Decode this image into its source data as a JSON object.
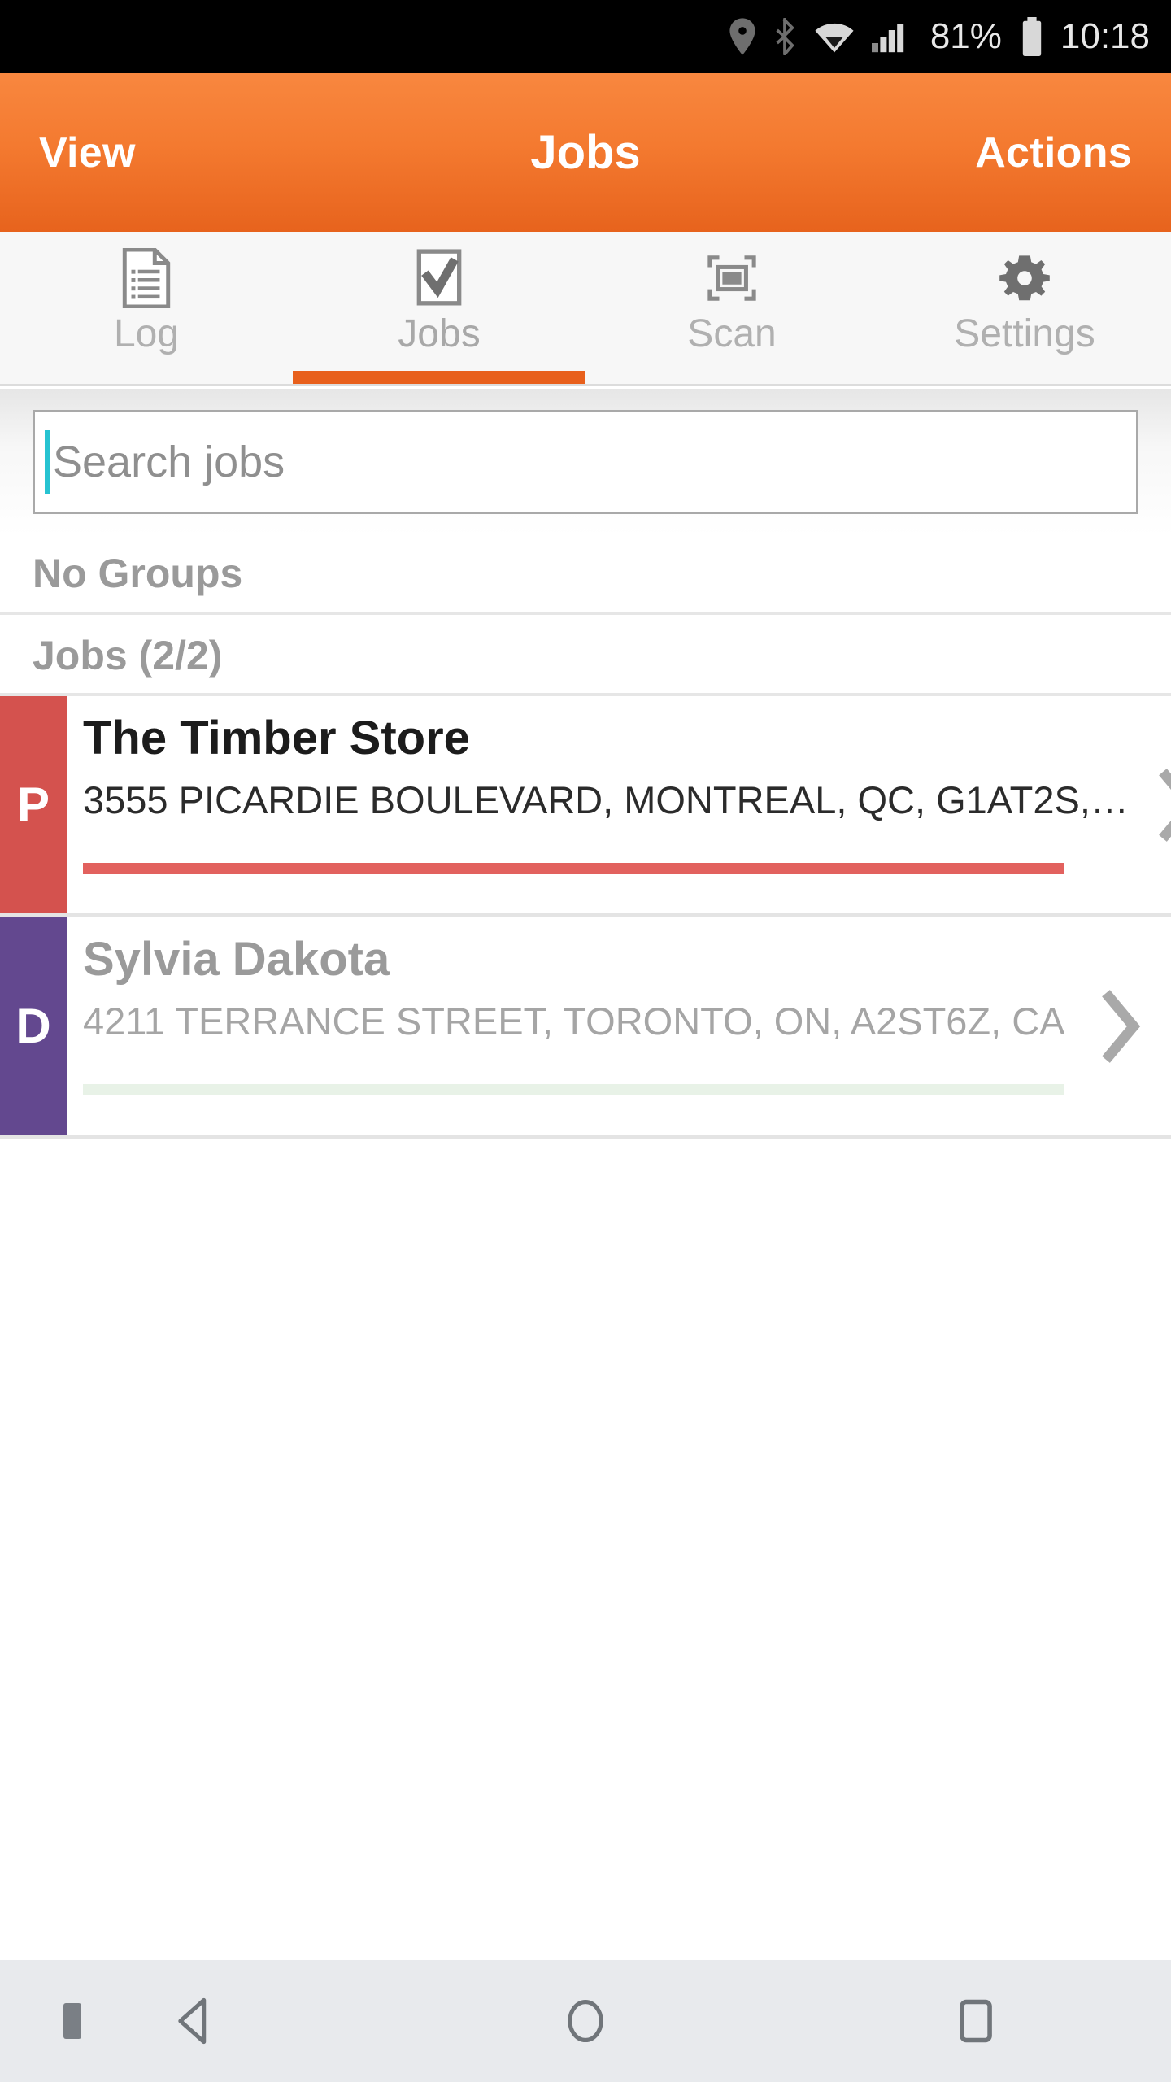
{
  "status_bar": {
    "battery_percent": "81%",
    "time": "10:18",
    "icons": [
      "location-pin-icon",
      "bluetooth-icon",
      "wifi-icon",
      "cellular-signal-icon",
      "battery-icon"
    ]
  },
  "header": {
    "left_button": "View",
    "title": "Jobs",
    "right_button": "Actions",
    "accent_color": "#e8601c"
  },
  "tabs": [
    {
      "label": "Log",
      "icon": "document-list-icon",
      "active": false
    },
    {
      "label": "Jobs",
      "icon": "checkbox-check-icon",
      "active": true
    },
    {
      "label": "Scan",
      "icon": "scan-frame-icon",
      "active": false
    },
    {
      "label": "Settings",
      "icon": "gear-icon",
      "active": false
    }
  ],
  "search": {
    "placeholder": "Search jobs",
    "value": "",
    "caret_color": "#27c3d1"
  },
  "sections": {
    "groups_header": "No Groups",
    "jobs_header": "Jobs (2/2)"
  },
  "jobs": [
    {
      "badge_letter": "P",
      "badge_color": "#d4524e",
      "title": "The Timber Store",
      "address": "3555 PICARDIE BOULEVARD, MONTREAL, QC, G1AT2S,…",
      "progress_percent": 100,
      "progress_color": "#e2615e",
      "progress_track_color": "#ffffff",
      "state": "active"
    },
    {
      "badge_letter": "D",
      "badge_color": "#63488f",
      "title": "Sylvia Dakota",
      "address": "4211 TERRANCE STREET, TORONTO, ON, A2ST6Z, CA",
      "progress_percent": 0,
      "progress_color": "#e8f2e7",
      "progress_track_color": "#e8f2e7",
      "state": "dimmed"
    }
  ],
  "nav_bar": {
    "buttons": [
      "back-triangle-icon",
      "home-circle-icon",
      "recents-square-icon"
    ],
    "dot": "nav-dot-icon"
  }
}
